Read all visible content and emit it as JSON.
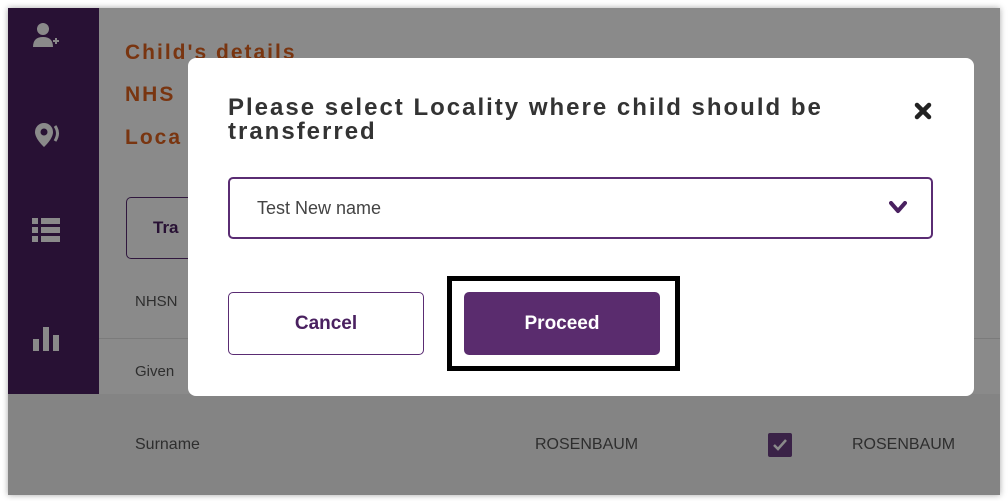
{
  "page": {
    "headings": [
      "Child's details",
      "NHS",
      "Loca"
    ],
    "tab_button_label": "Tra",
    "field_labels": [
      "NHSN",
      "Given"
    ],
    "surname_row": {
      "label": "Surname",
      "value_left": "ROSENBAUM",
      "value_right": "ROSENBAUM"
    }
  },
  "sidebar": {
    "icons": [
      "add-user-icon",
      "location-pin-icon",
      "list-icon",
      "bar-chart-icon",
      "asterisk-icon"
    ]
  },
  "modal": {
    "title": "Please select Locality where child should be transferred",
    "select_value": "Test New name",
    "cancel_label": "Cancel",
    "proceed_label": "Proceed"
  },
  "colors": {
    "sidebar": "#4a2160",
    "accent": "#5a2c6e",
    "heading": "#e0621f"
  }
}
